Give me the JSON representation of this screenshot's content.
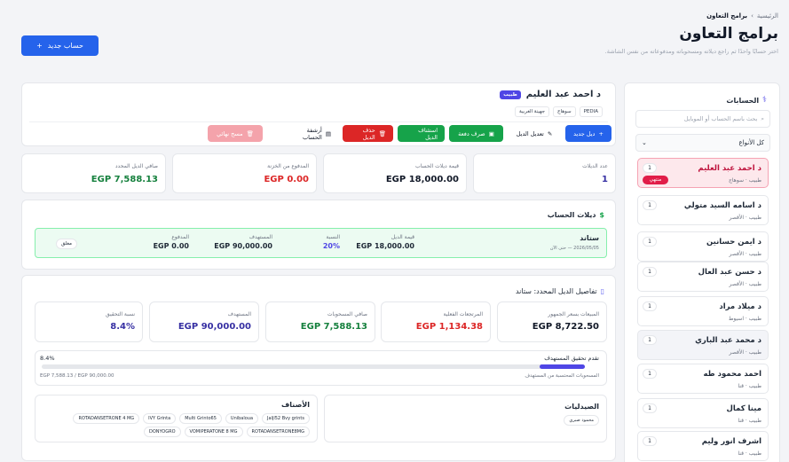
{
  "breadcrumb": {
    "home": "الرئيسية",
    "sep": "›",
    "current": "برامج التعاون"
  },
  "page": {
    "title": "برامج التعاون",
    "subtitle": "اختر حسابًا واحدًا ثم راجع ديلاته ومسحوباته ومدفوعاته من نفس الشاشة.",
    "new_account_label": "حساب جديد",
    "new_account_icon": "+"
  },
  "sidebar": {
    "title": "الحسابات",
    "search_placeholder": "بحث باسم الحساب أو الموبايل",
    "filter_label": "كل الأنواع",
    "items": [
      {
        "name": "د احمد عبد العليم",
        "sub": "طبيب · سوهاج",
        "count": "1",
        "badge": "منتهي"
      },
      {
        "name": "د اسامه السيد متولي",
        "sub": "طبيب · الأقصر",
        "count": "1"
      },
      {
        "name": "د ايمن حسانين",
        "sub": "طبيب · الأقصر",
        "count": "1"
      },
      {
        "name": "د حسن عبد العال",
        "sub": "طبيب · الأقصر",
        "count": "1"
      },
      {
        "name": "د ميلاد مراد",
        "sub": "طبيب · اسيوط",
        "count": "1"
      },
      {
        "name": "د محمد عبد الباري",
        "sub": "طبيب · الأقصر",
        "count": "1"
      },
      {
        "name": "احمد محمود طه",
        "sub": "طبيب · قنا",
        "count": "1"
      },
      {
        "name": "مينا كمال",
        "sub": "طبيب · قنا",
        "count": "1"
      },
      {
        "name": "اشرف انور وليم",
        "sub": "طبيب · قنا",
        "count": "1"
      }
    ]
  },
  "account": {
    "name": "د احمد عبد العليم",
    "type": "طبيب",
    "chips": [
      "PEDIA",
      "سوهاج",
      "جهينة الغربية"
    ],
    "actions": {
      "new_cycle": "ديل جديد",
      "edit_cycle": "تعديل الديل",
      "pay": "صرف دفعة",
      "resume": "استئناف الديل",
      "delete": "حذف الديل",
      "archive": "أرشفة الحساب",
      "wipe": "مسح نهائي"
    }
  },
  "stats": [
    {
      "label": "عدد الديلات",
      "value": "1",
      "color": "#3730a3"
    },
    {
      "label": "قيمة ديلات الحساب",
      "value": "EGP 18,000.00",
      "color": "#111827"
    },
    {
      "label": "المدفوع من الخزنة",
      "value": "EGP 0.00",
      "color": "#dc2626"
    },
    {
      "label": "صافي الديل المحدد",
      "value": "EGP 7,588.13",
      "color": "#15803d"
    }
  ],
  "transactions": {
    "title": "ديلات الحساب",
    "row": {
      "name": "ستاند",
      "date": "2026/05/05 — حتى الآن",
      "value_label": "قيمة الديل",
      "value": "EGP 18,000.00",
      "ratio_label": "النسبة",
      "ratio": "20%",
      "target_label": "المستهدف",
      "target": "EGP 90,000.00",
      "paid_label": "المدفوع",
      "paid": "EGP 0.00",
      "status": "مغلق"
    }
  },
  "details": {
    "title": "تفاصيل الديل المحدد: ستاند",
    "cards": [
      {
        "label": "المبيعات بسعر الجمهور",
        "value": "EGP 8,722.50",
        "color": "#111827"
      },
      {
        "label": "المرتجعات الفعلية",
        "value": "EGP 1,134.38",
        "color": "#dc2626"
      },
      {
        "label": "صافي المسحوبات",
        "value": "EGP 7,588.13",
        "color": "#15803d"
      },
      {
        "label": "المستهدف",
        "value": "EGP 90,000.00",
        "color": "#3730a3"
      },
      {
        "label": "نسبة التحقيق",
        "value": "8.4%",
        "color": "#3730a3"
      }
    ],
    "progress": {
      "title": "تقدم تحقيق المستهدف",
      "percent_label": "8.4%",
      "percent": 8.4,
      "footnote": "المسحوبات المحتسبة من المستهدف",
      "amounts": "EGP 7,588.13 / EGP 90,000.00"
    },
    "pharmacies": {
      "title": "الصيدليات",
      "items": [
        "محمود صبري"
      ]
    },
    "products": {
      "title": "الأصناف",
      "items": [
        "Jaljl52 Bvy grints",
        "Unibaloua",
        "Multi Grinto65",
        "IVY Grinta",
        "ROTADANSETRONE 4 MG",
        "ROTADANSETRONE8MG",
        "VOMIPERATONE 8 MG",
        "DONYOGRO"
      ]
    }
  }
}
